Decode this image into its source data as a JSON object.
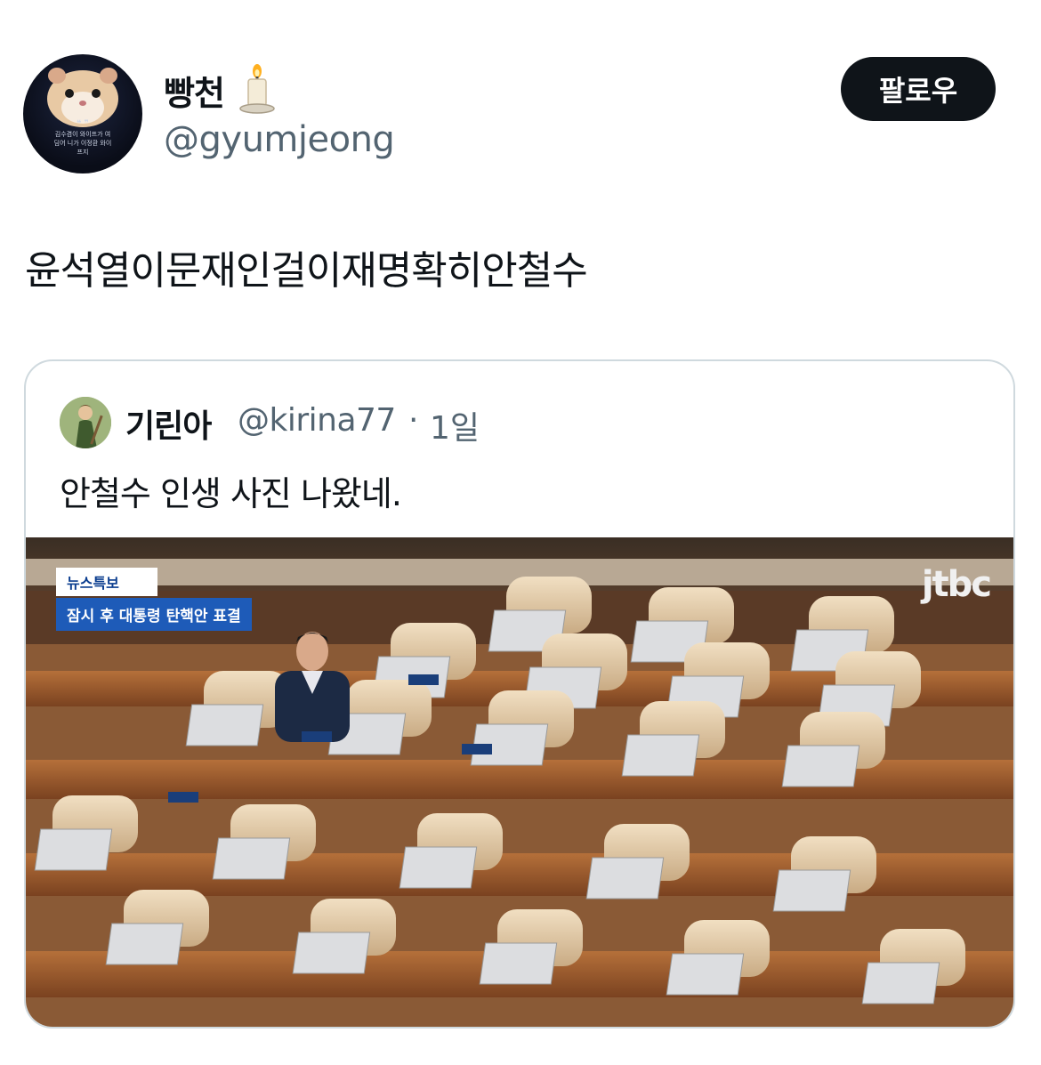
{
  "author": {
    "display_name": "빵천",
    "emoji": "candle-icon",
    "handle": "@gyumjeong",
    "avatar_caption_line1": "김수겸이 와이프가 여",
    "avatar_caption_line2": "딤어 니가 이정환 와이",
    "avatar_caption_line3": "프지"
  },
  "follow_button": {
    "label": "팔로우"
  },
  "tweet": {
    "text": "윤석열이문재인걸이재명확히안철수"
  },
  "quoted_tweet": {
    "display_name": "기린아",
    "handle": "@kirina77",
    "separator": "·",
    "time": "1일",
    "text": "안철수 인생 사진 나왔네.",
    "media": {
      "news_label": "뉴스특보",
      "news_headline": "잠시 후 대통령 탄핵안 표결",
      "broadcaster": "JTBC"
    }
  },
  "colors": {
    "text": "#0f1419",
    "secondary": "#536471",
    "border": "#cfd9de",
    "button": "#0f1419"
  }
}
